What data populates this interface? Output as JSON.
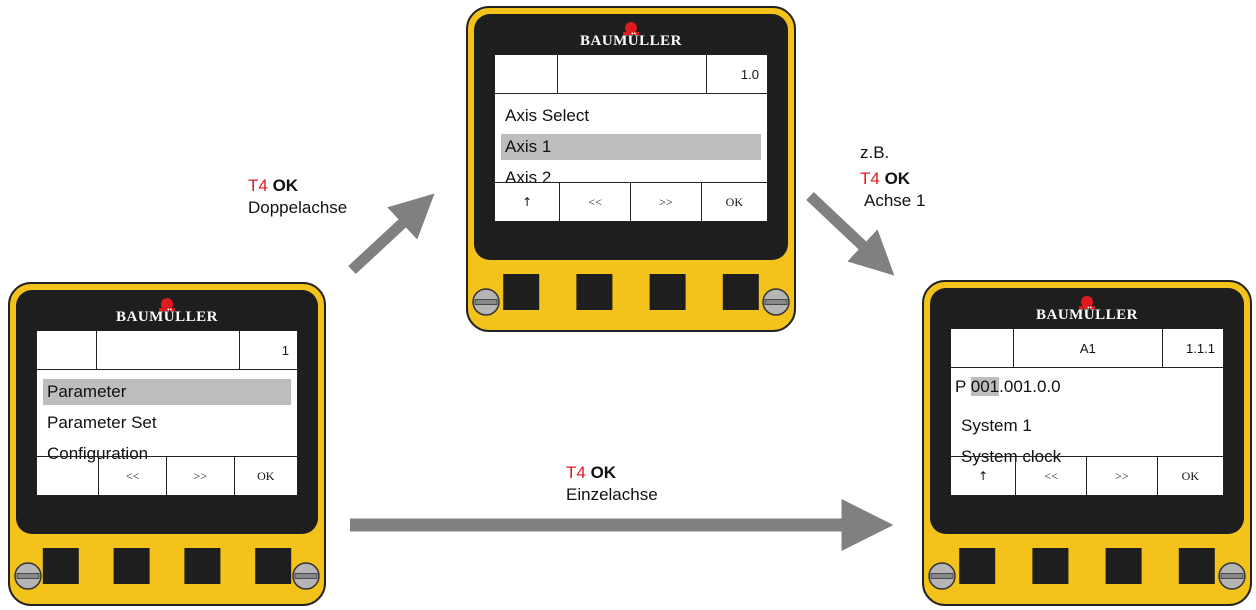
{
  "brand": "BAUMÜLLER",
  "colors": {
    "housing": "#f3c31b",
    "bezel": "#1e1e1e",
    "accent_red": "#e0191f",
    "arrow": "#808080",
    "highlight": "#bdbdbd"
  },
  "devices": {
    "left": {
      "header": [
        "",
        "",
        "1"
      ],
      "lines": [
        {
          "text": "Parameter",
          "selected": true
        },
        {
          "text": "Parameter Set",
          "selected": false
        },
        {
          "text": "Configuration",
          "selected": false
        }
      ],
      "softkeys": [
        "",
        "<<",
        ">>",
        "OK"
      ]
    },
    "middle": {
      "header": [
        "",
        "",
        "1.0"
      ],
      "lines": [
        {
          "text": "Axis Select",
          "selected": false
        },
        {
          "text": "Axis 1",
          "selected": true
        },
        {
          "text": "Axis 2",
          "selected": false
        }
      ],
      "softkeys": [
        "↑",
        "<<",
        ">>",
        "OK"
      ]
    },
    "right": {
      "header": [
        "",
        "A1",
        "1.1.1"
      ],
      "param_prefix": "P ",
      "param_selected": "001",
      "param_rest": ".001.0.0",
      "lines": [
        {
          "text": "System 1",
          "selected": false
        },
        {
          "text": "System clock",
          "selected": false
        }
      ],
      "softkeys": [
        "↑",
        "<<",
        ">>",
        "OK"
      ]
    }
  },
  "transitions": {
    "to_middle": {
      "key": "T4",
      "action": "OK",
      "desc": "Doppelachse"
    },
    "to_right_from_middle": {
      "prefix": "z.B.",
      "key": "T4",
      "action": "OK",
      "desc": "Achse 1"
    },
    "to_right_from_left": {
      "key": "T4",
      "action": "OK",
      "desc": "Einzelachse"
    }
  }
}
